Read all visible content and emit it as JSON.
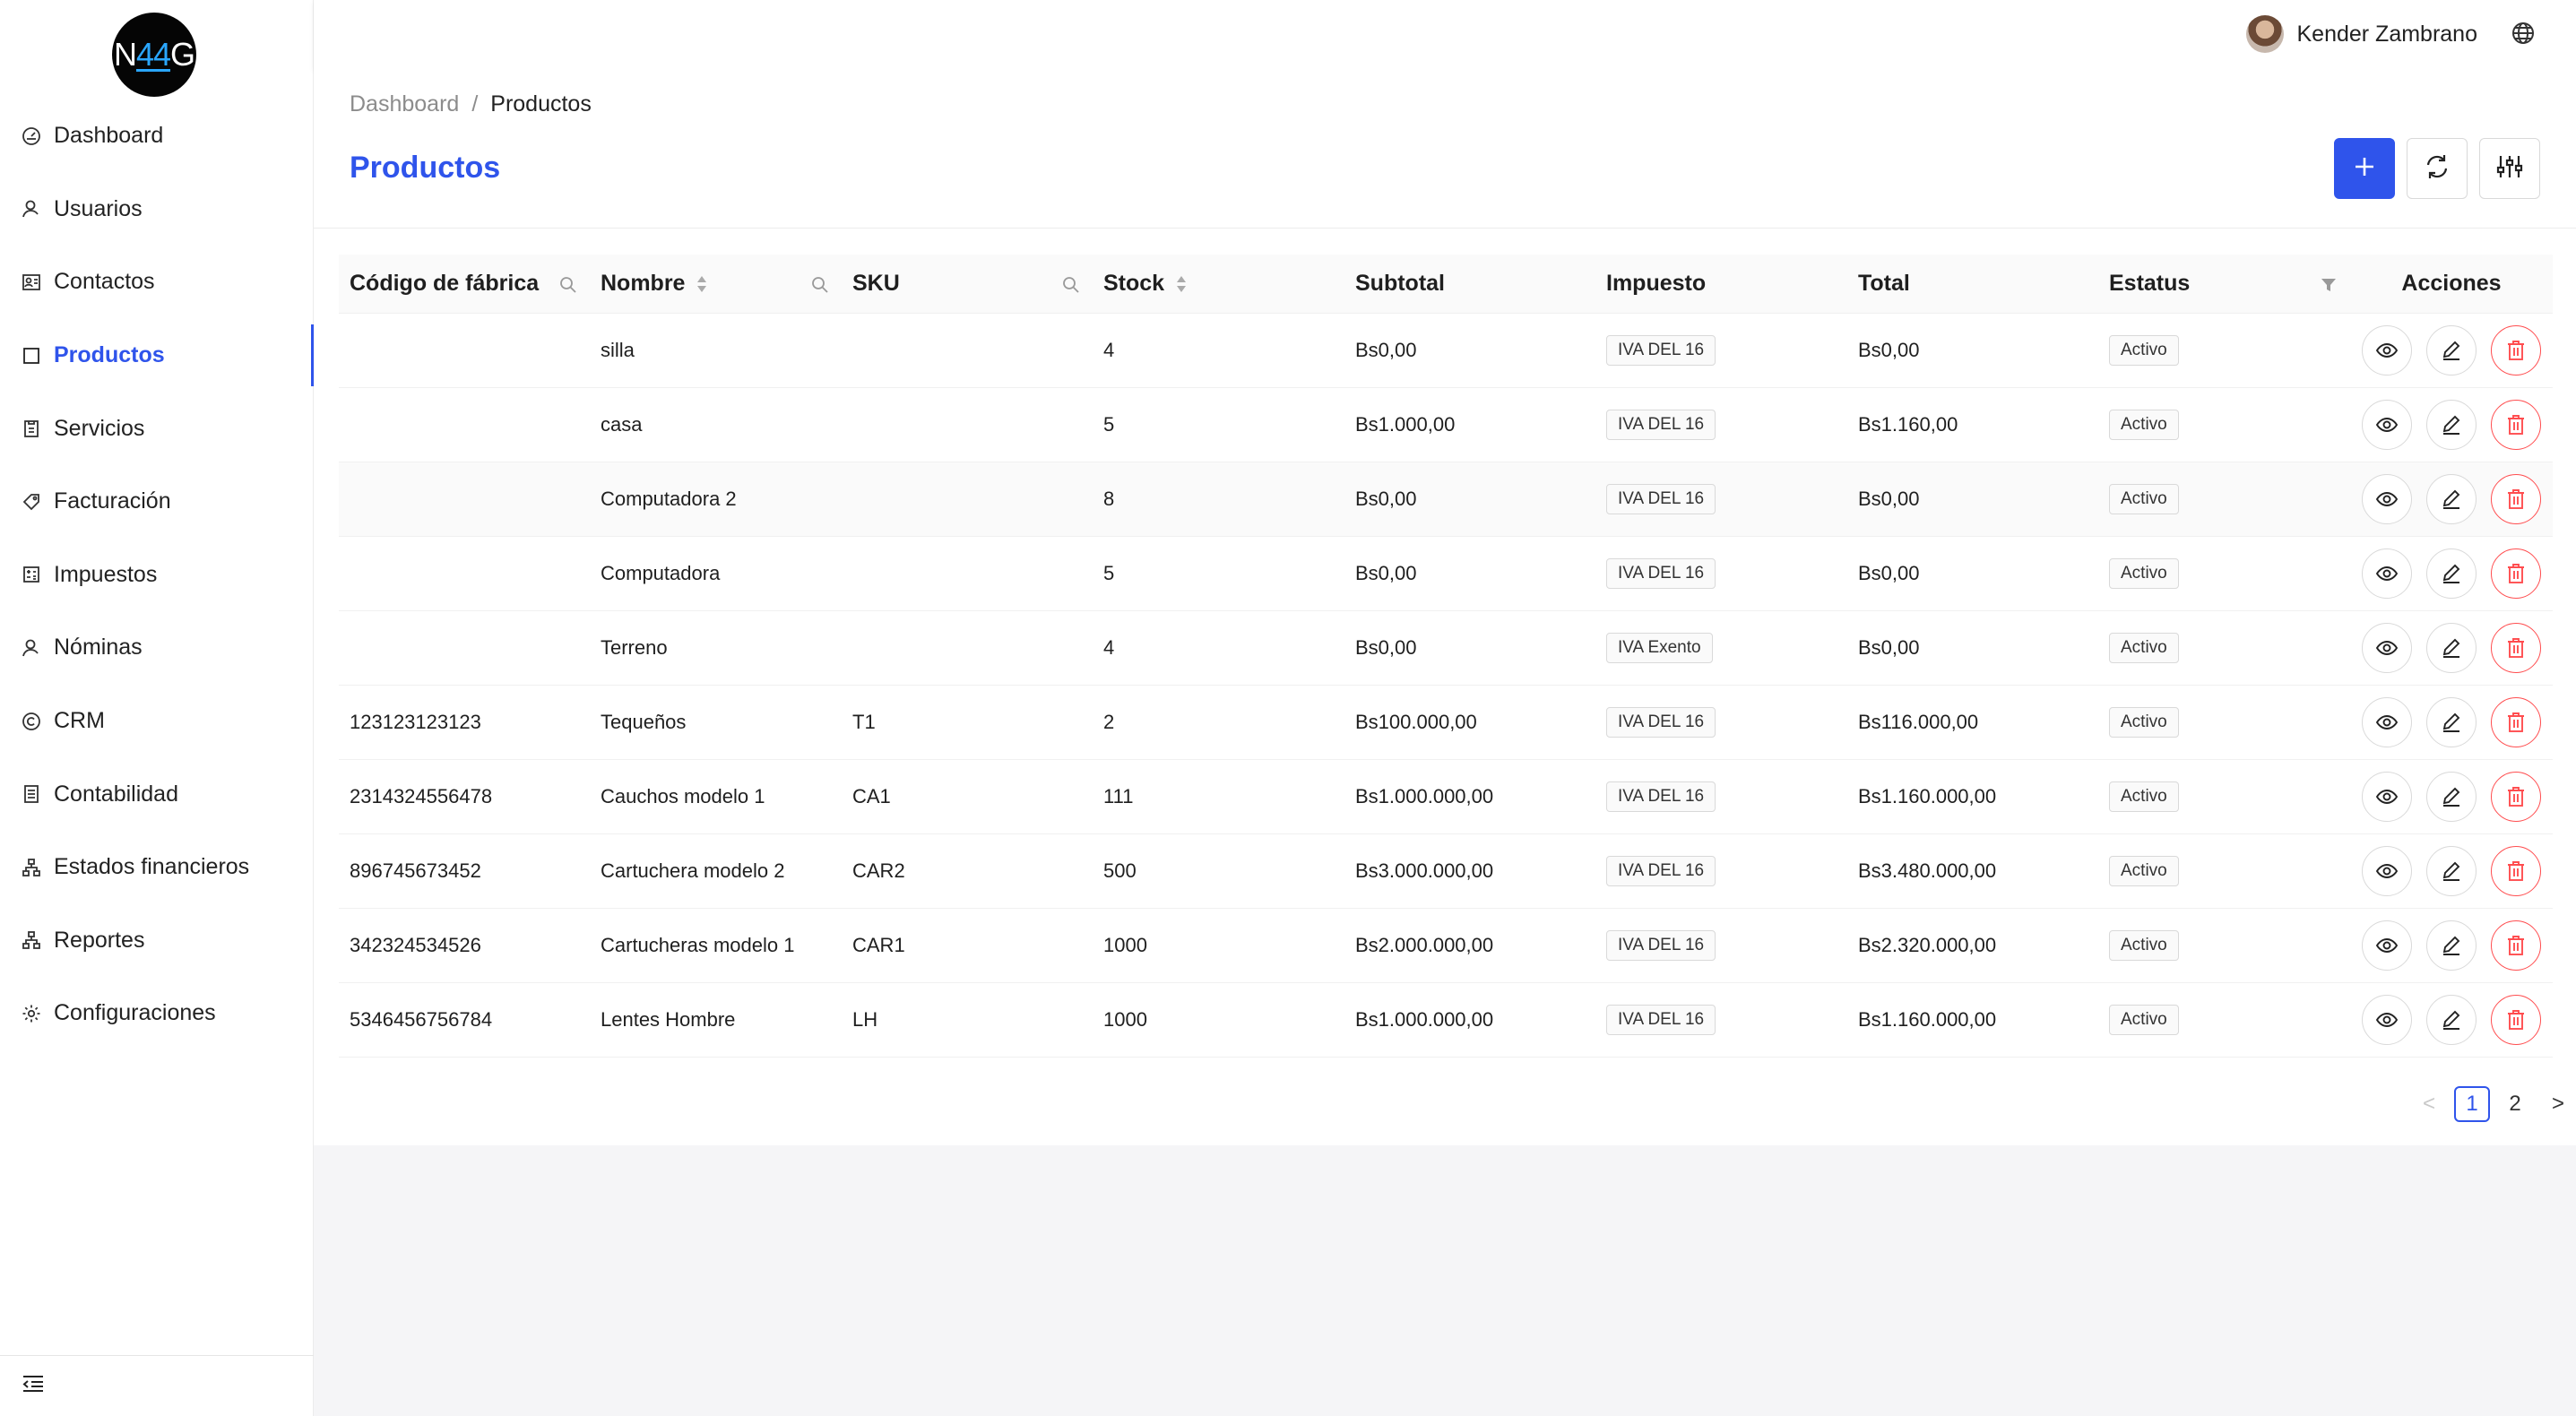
{
  "logo": {
    "left": "N",
    "mid": "44",
    "right": "G"
  },
  "sidebar": {
    "items": [
      {
        "label": "Dashboard",
        "icon": "dashboard-icon"
      },
      {
        "label": "Usuarios",
        "icon": "user-icon"
      },
      {
        "label": "Contactos",
        "icon": "contacts-icon"
      },
      {
        "label": "Productos",
        "icon": "box-icon",
        "active": true
      },
      {
        "label": "Servicios",
        "icon": "clipboard-icon"
      },
      {
        "label": "Facturación",
        "icon": "tag-icon"
      },
      {
        "label": "Impuestos",
        "icon": "calculator-icon"
      },
      {
        "label": "Nóminas",
        "icon": "user-icon"
      },
      {
        "label": "CRM",
        "icon": "copyright-icon"
      },
      {
        "label": "Contabilidad",
        "icon": "book-icon"
      },
      {
        "label": "Estados financieros",
        "icon": "cluster-icon"
      },
      {
        "label": "Reportes",
        "icon": "cluster-icon"
      },
      {
        "label": "Configuraciones",
        "icon": "gear-icon"
      }
    ]
  },
  "header": {
    "user_name": "Kender Zambrano"
  },
  "breadcrumb": {
    "root": "Dashboard",
    "separator": "/",
    "current": "Productos"
  },
  "page": {
    "title": "Productos"
  },
  "table": {
    "columns": [
      "Código de fábrica",
      "Nombre",
      "SKU",
      "Stock",
      "Subtotal",
      "Impuesto",
      "Total",
      "Estatus",
      "Acciones"
    ],
    "rows": [
      {
        "codigo": "",
        "nombre": "silla",
        "sku": "",
        "stock": "4",
        "subtotal": "Bs0,00",
        "impuesto": "IVA DEL 16",
        "total": "Bs0,00",
        "estatus": "Activo"
      },
      {
        "codigo": "",
        "nombre": "casa",
        "sku": "",
        "stock": "5",
        "subtotal": "Bs1.000,00",
        "impuesto": "IVA DEL 16",
        "total": "Bs1.160,00",
        "estatus": "Activo"
      },
      {
        "codigo": "",
        "nombre": "Computadora 2",
        "sku": "",
        "stock": "8",
        "subtotal": "Bs0,00",
        "impuesto": "IVA DEL 16",
        "total": "Bs0,00",
        "estatus": "Activo"
      },
      {
        "codigo": "",
        "nombre": "Computadora",
        "sku": "",
        "stock": "5",
        "subtotal": "Bs0,00",
        "impuesto": "IVA DEL 16",
        "total": "Bs0,00",
        "estatus": "Activo"
      },
      {
        "codigo": "",
        "nombre": "Terreno",
        "sku": "",
        "stock": "4",
        "subtotal": "Bs0,00",
        "impuesto": "IVA Exento",
        "total": "Bs0,00",
        "estatus": "Activo"
      },
      {
        "codigo": "123123123123",
        "nombre": "Tequeños",
        "sku": "T1",
        "stock": "2",
        "subtotal": "Bs100.000,00",
        "impuesto": "IVA DEL 16",
        "total": "Bs116.000,00",
        "estatus": "Activo"
      },
      {
        "codigo": "2314324556478",
        "nombre": "Cauchos modelo 1",
        "sku": "CA1",
        "stock": "111",
        "subtotal": "Bs1.000.000,00",
        "impuesto": "IVA DEL 16",
        "total": "Bs1.160.000,00",
        "estatus": "Activo"
      },
      {
        "codigo": "896745673452",
        "nombre": "Cartuchera modelo 2",
        "sku": "CAR2",
        "stock": "500",
        "subtotal": "Bs3.000.000,00",
        "impuesto": "IVA DEL 16",
        "total": "Bs3.480.000,00",
        "estatus": "Activo"
      },
      {
        "codigo": "342324534526",
        "nombre": "Cartucheras modelo 1",
        "sku": "CAR1",
        "stock": "1000",
        "subtotal": "Bs2.000.000,00",
        "impuesto": "IVA DEL 16",
        "total": "Bs2.320.000,00",
        "estatus": "Activo"
      },
      {
        "codigo": "5346456756784",
        "nombre": "Lentes Hombre",
        "sku": "LH",
        "stock": "1000",
        "subtotal": "Bs1.000.000,00",
        "impuesto": "IVA DEL 16",
        "total": "Bs1.160.000,00",
        "estatus": "Activo"
      }
    ]
  },
  "pagination": {
    "pages": [
      "1",
      "2"
    ],
    "current": "1",
    "prev": "<",
    "next": ">"
  },
  "colors": {
    "primary": "#2f54eb",
    "danger": "#ff4d4f"
  }
}
